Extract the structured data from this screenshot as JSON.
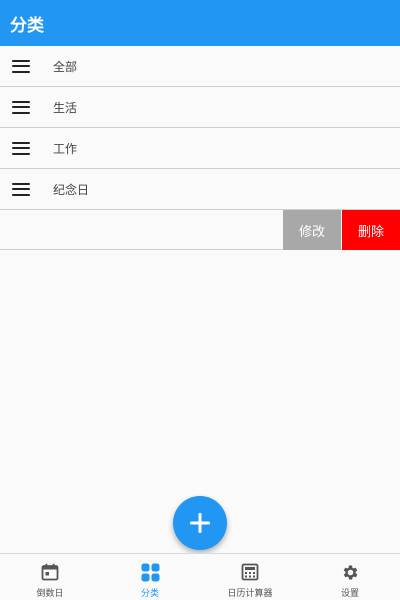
{
  "header": {
    "title": "分类"
  },
  "categories": [
    {
      "label": "全部"
    },
    {
      "label": "生活"
    },
    {
      "label": "工作"
    },
    {
      "label": "纪念日"
    }
  ],
  "swipe_actions": {
    "edit_label": "修改",
    "delete_label": "删除"
  },
  "bottom_nav": [
    {
      "label": "倒数日",
      "icon": "calendar-icon"
    },
    {
      "label": "分类",
      "icon": "grid-icon",
      "active": true
    },
    {
      "label": "日历计算器",
      "icon": "calculator-icon"
    },
    {
      "label": "设置",
      "icon": "gear-icon"
    }
  ],
  "colors": {
    "primary": "#2196f3",
    "delete": "#ff0000",
    "edit": "#a8a8a8"
  }
}
